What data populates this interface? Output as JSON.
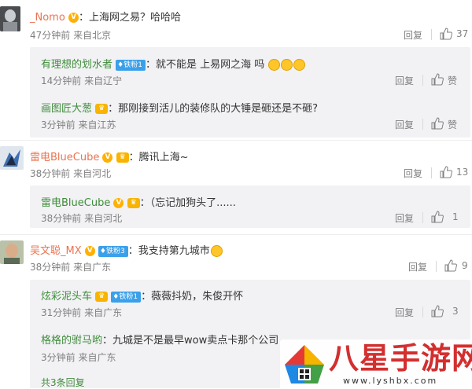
{
  "comments": [
    {
      "user": "_Nomo",
      "verified": "V",
      "text": "：上海网之易？哈哈哈",
      "time": "47分钟前",
      "location": "来自北京",
      "reply_label": "回复",
      "likes": "37"
    },
    {
      "user": "雷电BlueCube",
      "verified": "V",
      "text": "：腾讯上海~",
      "time": "38分钟前",
      "location": "来自河北",
      "reply_label": "回复",
      "likes": "13"
    },
    {
      "user": "吴文聪_MX",
      "verified": "V",
      "fan_badge": "铁粉3",
      "text": "：我支持第九城市",
      "time": "38分钟前",
      "location": "来自广东",
      "reply_label": "回复",
      "likes": "9"
    }
  ],
  "replies1": [
    {
      "user": "有理想的划水者",
      "fan_badge": "铁粉1",
      "text": "：就不能是 上易网之海 吗",
      "time": "14分钟前",
      "location": "来自辽宁",
      "reply_label": "回复",
      "likes": "赞"
    },
    {
      "user": "画图匠大葱",
      "text": "：那刚接到活儿的装修队的大锤是砸还是不砸?",
      "time": "3分钟前",
      "location": "来自江苏",
      "reply_label": "回复",
      "likes": "赞"
    }
  ],
  "replies2": [
    {
      "user": "雷电BlueCube",
      "verified": "V",
      "text": "：（忘记加狗头了......",
      "time": "38分钟前",
      "location": "来自河北",
      "reply_label": "回复",
      "likes": "1"
    }
  ],
  "replies3": [
    {
      "user": "炫彩泥头车",
      "fan_badge": "铁粉1",
      "text": "：薇薇抖奶，朱俊开怀",
      "time": "31分钟前",
      "location": "来自广东",
      "reply_label": "回复",
      "likes": "3"
    },
    {
      "user": "格格的驸马哟",
      "text": "：九城是不是最早wow卖点卡那个公司",
      "time": "3分钟前",
      "location": "来自广东"
    }
  ],
  "more_replies": "共3条回复",
  "watermark": {
    "brand": "八星手游网",
    "url": "www.lyshbx.com"
  },
  "colors": {
    "name": "#eb7350",
    "reply_name": "#3f8d3a",
    "meta": "#808080",
    "subbox": "#f2f2f5"
  }
}
